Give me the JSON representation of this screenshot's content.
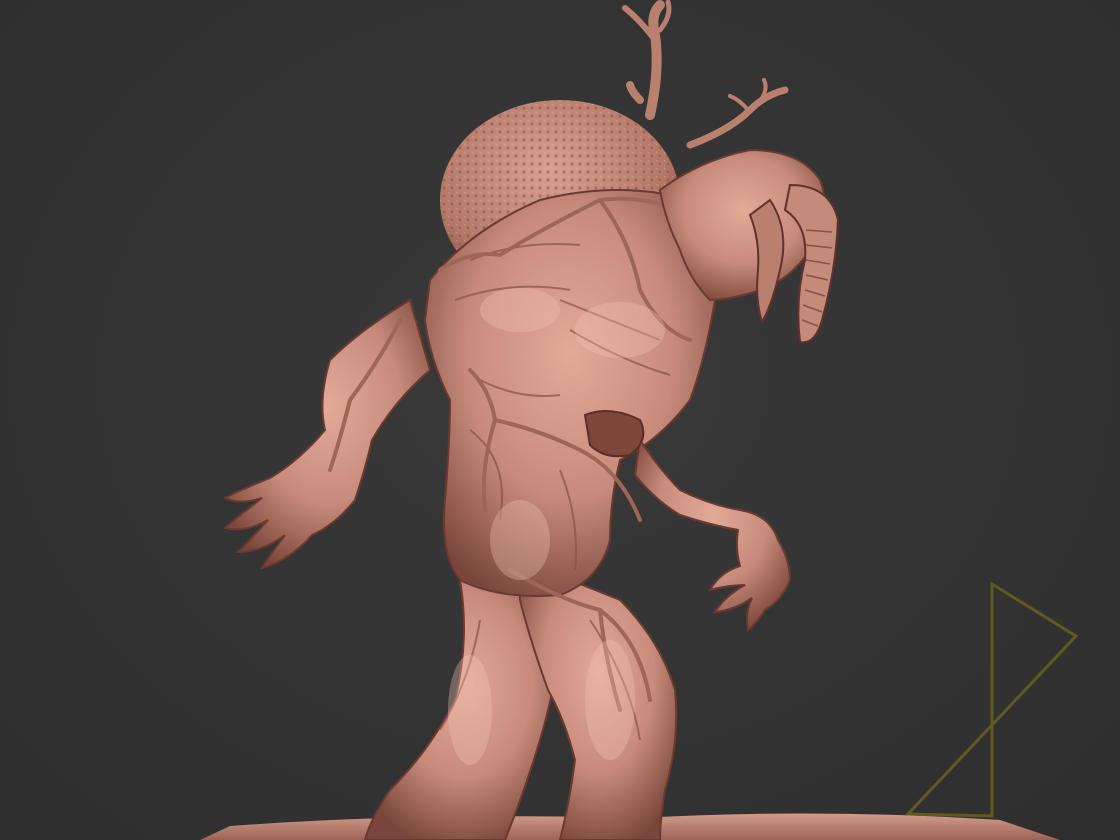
{
  "viewport": {
    "background_color": "#333333",
    "material_color": "#c98f7f",
    "material_shadow_color": "#6e3d33",
    "material_highlight_color": "#e8b7a6",
    "gizmo_color": "#5f5a1f"
  },
  "scene": {
    "model_name": "creature-sculpt-icon",
    "gizmo_name": "floor-grid-axis-icon"
  }
}
